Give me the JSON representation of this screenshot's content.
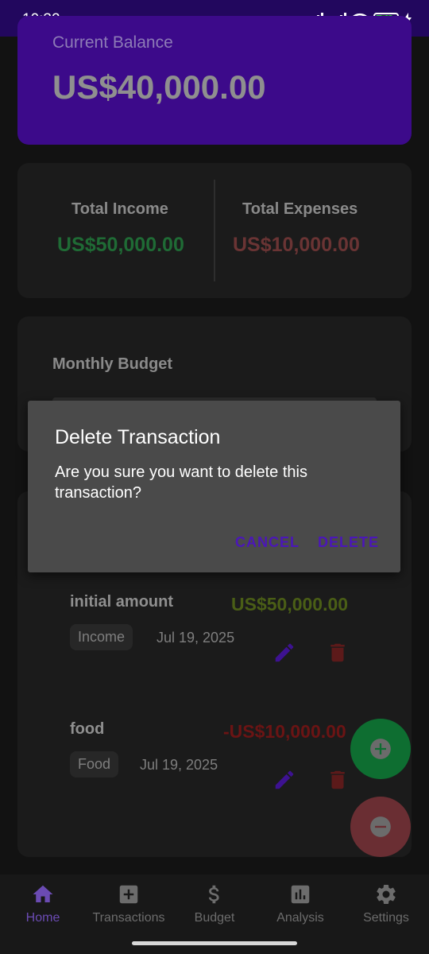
{
  "status": {
    "time": "10:32",
    "battery": "79"
  },
  "balance": {
    "label": "Current Balance",
    "value": "US$40,000.00"
  },
  "summary": {
    "income_label": "Total Income",
    "income_value": "US$50,000.00",
    "expense_label": "Total Expenses",
    "expense_value": "US$10,000.00"
  },
  "budget": {
    "label": "Monthly Budget"
  },
  "transactions": [
    {
      "name": "initial amount",
      "amount": "US$50,000.00",
      "category": "Income",
      "date": "Jul 19, 2025",
      "color": "#4a5e16"
    },
    {
      "name": "food",
      "amount": "-US$10,000.00",
      "category": "Food",
      "date": "Jul 19, 2025",
      "color": "#6b1414"
    }
  ],
  "dialog": {
    "title": "Delete Transaction",
    "message": "Are you sure you want to delete this transaction?",
    "cancel": "CANCEL",
    "delete": "DELETE"
  },
  "nav": {
    "items": [
      {
        "label": "Home",
        "icon": "home-icon"
      },
      {
        "label": "Transactions",
        "icon": "add-box-icon"
      },
      {
        "label": "Budget",
        "icon": "dollar-icon"
      },
      {
        "label": "Analysis",
        "icon": "bar-chart-icon"
      },
      {
        "label": "Settings",
        "icon": "gear-icon"
      }
    ],
    "active": "Home"
  },
  "colors": {
    "accent": "#4b16b8",
    "income": "#1f6b35",
    "expense": "#6a3434",
    "fab_add": "#0e6e31",
    "fab_remove": "#6a2e33"
  }
}
